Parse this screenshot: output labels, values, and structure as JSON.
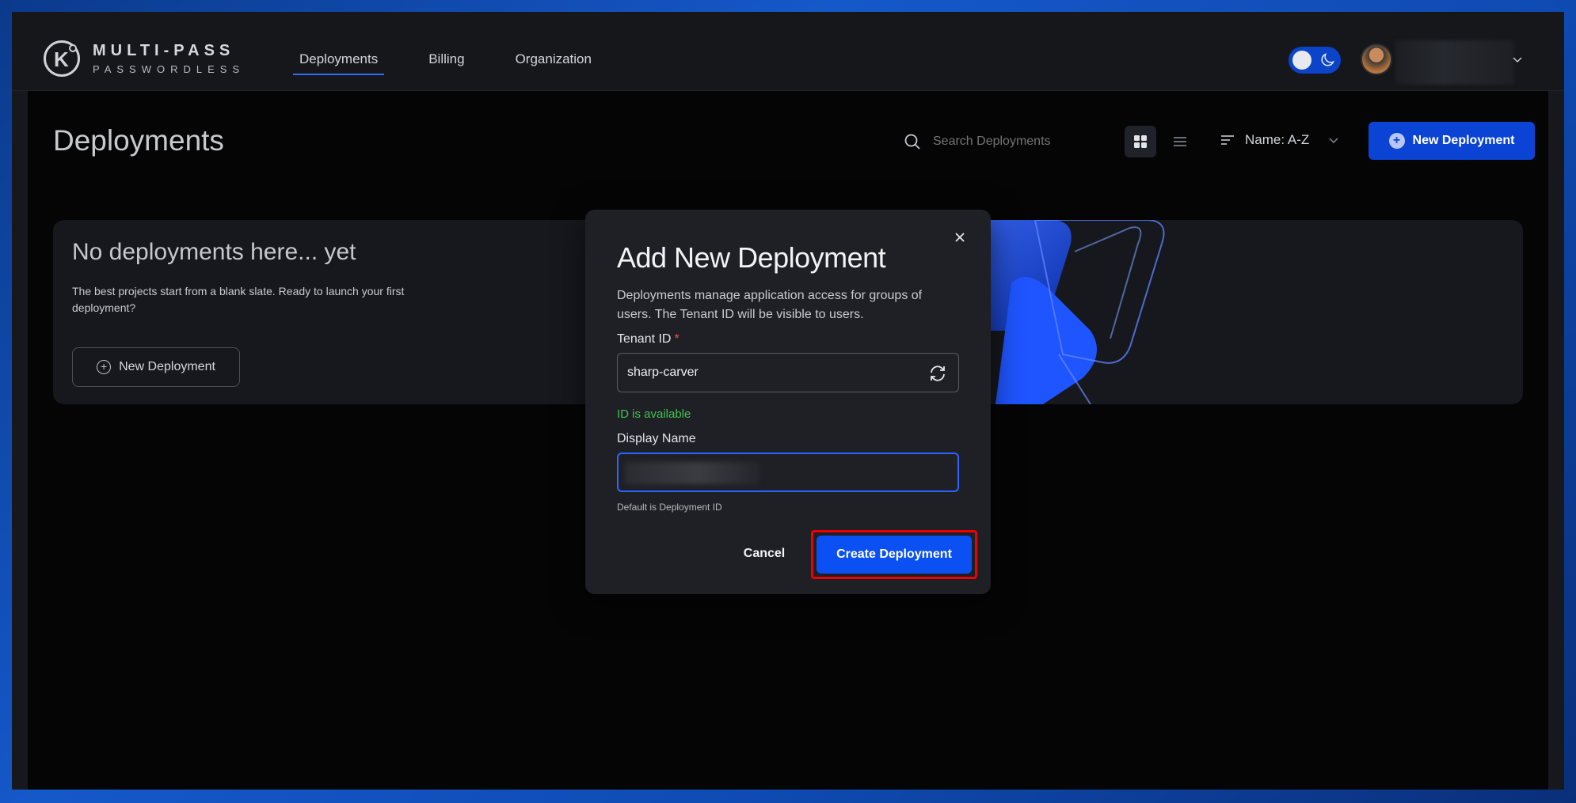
{
  "brand": {
    "line1": "MULTI-PASS",
    "line2": "PASSWORDLESS",
    "mark": "K"
  },
  "nav": [
    {
      "label": "Deployments",
      "active": true
    },
    {
      "label": "Billing",
      "active": false
    },
    {
      "label": "Organization",
      "active": false
    }
  ],
  "header": {
    "theme": "dark",
    "accent": "#0b43c9"
  },
  "page": {
    "title": "Deployments",
    "search_placeholder": "Search Deployments",
    "sort_label": "Name: A-Z",
    "new_button": "New Deployment",
    "view_mode": "grid"
  },
  "empty_state": {
    "title": "No deployments here... yet",
    "description": "The best projects start from a blank slate. Ready to launch your first deployment?",
    "button": "New Deployment"
  },
  "modal": {
    "title": "Add New Deployment",
    "description": "Deployments manage application access for groups of users. The Tenant ID will be visible to users.",
    "tenant_label": "Tenant ID",
    "required_mark": "*",
    "tenant_value": "sharp-carver",
    "availability": "ID is available",
    "display_label": "Display Name",
    "display_hint": "Default is Deployment ID",
    "cancel": "Cancel",
    "create": "Create Deployment"
  },
  "colors": {
    "primary": "#0b50f2",
    "success": "#3fc54f",
    "required": "#ff4d4d",
    "highlight": "#e00000"
  }
}
